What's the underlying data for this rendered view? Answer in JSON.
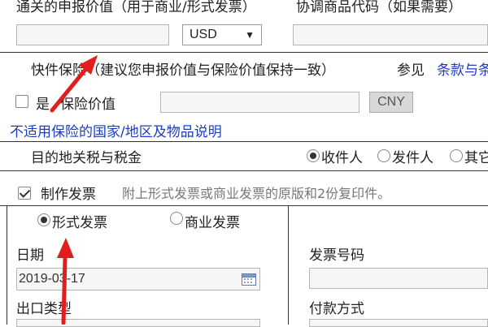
{
  "row_customs": {
    "customs_value_label": "通关的申报价值（用于商业/形式发票）",
    "commodity_code_label": "协调商品代码（如果需要）",
    "customs_value_input": "",
    "currency_select": "USD",
    "commodity_code_input": ""
  },
  "insurance": {
    "title": "快件保险（建议您申报价值与保险价值保持一致）",
    "see_label": "参见",
    "terms_link": "条款与条",
    "yes_label": "是",
    "insured_value_label": "保险价值",
    "insured_value_input": "",
    "currency": "CNY",
    "not_applicable_link": "不适用保险的国家/地区及物品说明"
  },
  "duties": {
    "label": "目的地关税与税金",
    "options": [
      "收件人",
      "发件人",
      "其它"
    ],
    "selected": "收件人"
  },
  "invoice": {
    "create_label": "制作发票",
    "note": "附上形式发票或商业发票的原版和2份复印件。",
    "type_proforma": "形式发票",
    "type_commercial": "商业发票",
    "date_label": "日期",
    "date_value": "2019-03-17",
    "export_type_label": "出口类型",
    "invoice_number_label": "发票号码",
    "invoice_number_input": "",
    "payment_method_label": "付款方式"
  },
  "colors": {
    "annotation_arrow": "#e01e1e",
    "link": "#1a3ccc"
  },
  "icons": {
    "calendar": "calendar-icon",
    "dropdown": "chevron-down-icon"
  }
}
